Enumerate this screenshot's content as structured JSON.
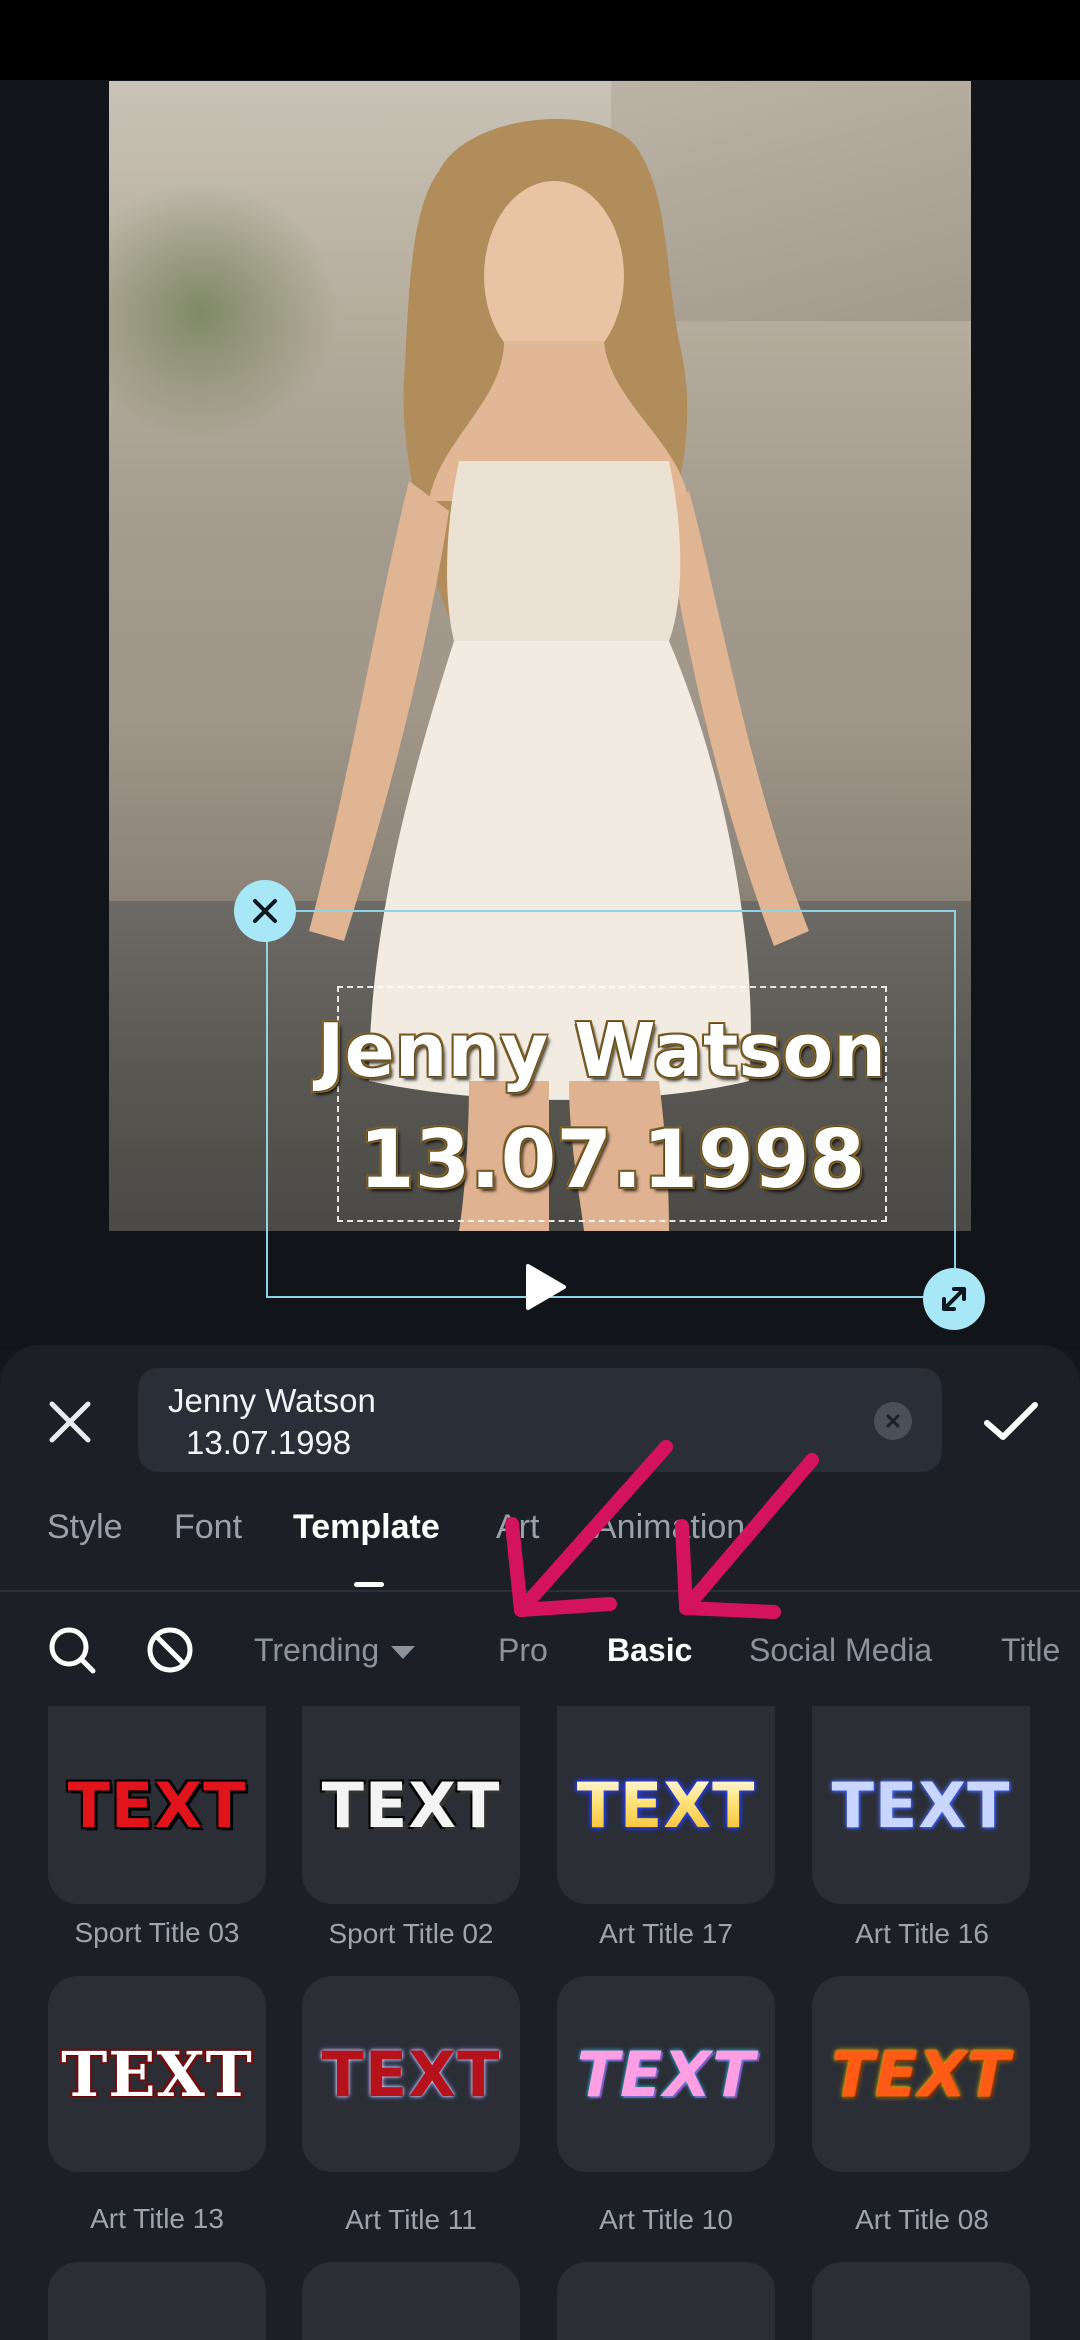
{
  "preview": {
    "overlay_line1": "Jenny Watson",
    "overlay_line2": "13.07.1998"
  },
  "editor": {
    "input_line1": "Jenny Watson",
    "input_line2": "13.07.1998"
  },
  "tabs": [
    {
      "label": "Style",
      "active": false
    },
    {
      "label": "Font",
      "active": false
    },
    {
      "label": "Template",
      "active": true
    },
    {
      "label": "Art",
      "active": false
    },
    {
      "label": "Animation",
      "active": false
    }
  ],
  "categories": [
    {
      "label": "Trending",
      "active": false
    },
    {
      "label": "Pro",
      "active": false
    },
    {
      "label": "Basic",
      "active": true
    },
    {
      "label": "Social Media",
      "active": false
    },
    {
      "label": "Title",
      "active": false
    }
  ],
  "templates": [
    {
      "name": "Sport Title 03",
      "sample": "TEXT"
    },
    {
      "name": "Sport Title 02",
      "sample": "TEXT"
    },
    {
      "name": "Art Title 17",
      "sample": "TEXT"
    },
    {
      "name": "Art Title 16",
      "sample": "TEXT"
    },
    {
      "name": "Art Title 13",
      "sample": "TEXT"
    },
    {
      "name": "Art Title 11",
      "sample": "TEXT"
    },
    {
      "name": "Art Title 10",
      "sample": "TEXT"
    },
    {
      "name": "Art Title 08",
      "sample": "TEXT"
    }
  ],
  "colors": {
    "selection_handle": "#a8e7f5",
    "annotation_arrow": "#d4135f",
    "panel_bg": "#1c1f25"
  },
  "icons": {
    "delete_handle": "close-icon",
    "resize_handle": "resize-icon",
    "play": "play-icon",
    "close": "close-icon",
    "clear": "clear-icon",
    "confirm": "checkmark-icon",
    "search": "search-icon",
    "none": "no-style-icon",
    "dropdown": "caret-down-icon"
  }
}
